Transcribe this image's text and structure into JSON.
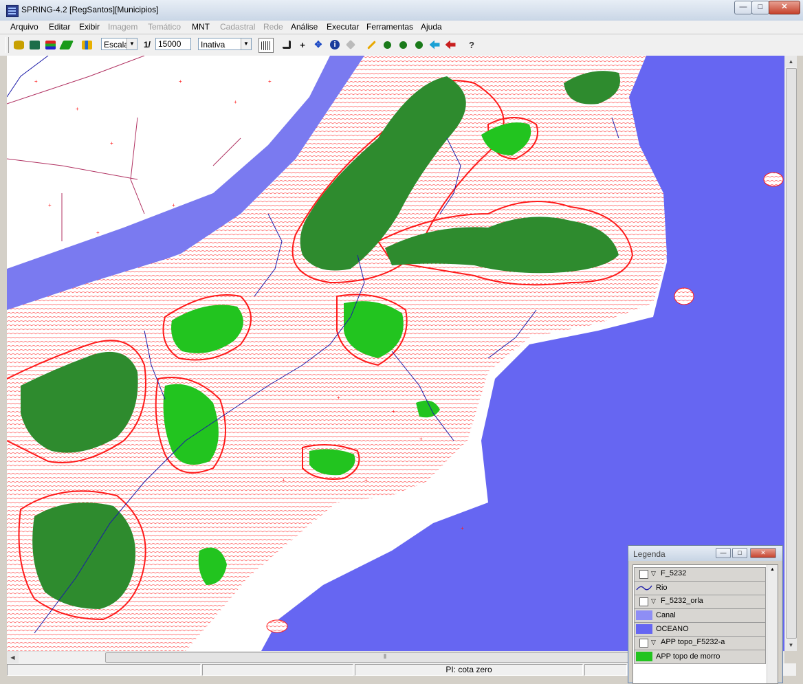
{
  "window": {
    "title": "SPRING-4.2 [RegSantos][Municipios]",
    "controls": {
      "minimize": "—",
      "maximize": "□",
      "close": "✕"
    }
  },
  "menu": [
    {
      "label": "Arquivo",
      "enabled": true
    },
    {
      "label": "Editar",
      "enabled": true
    },
    {
      "label": "Exibir",
      "enabled": true
    },
    {
      "label": "Imagem",
      "enabled": false
    },
    {
      "label": "Temático",
      "enabled": false
    },
    {
      "label": "MNT",
      "enabled": true
    },
    {
      "label": "Cadastral",
      "enabled": false
    },
    {
      "label": "Rede",
      "enabled": false
    },
    {
      "label": "Análise",
      "enabled": true
    },
    {
      "label": "Executar",
      "enabled": true
    },
    {
      "label": "Ferramentas",
      "enabled": true
    },
    {
      "label": "Ajuda",
      "enabled": true
    }
  ],
  "toolbar": {
    "scale_mode": "Escala",
    "scale_prefix": "1/",
    "scale_value": "15000",
    "cursor_mode": "Inativa",
    "icons": [
      "database-icon",
      "model-icon",
      "layers-icon",
      "draw-icon",
      "chart-icon",
      "grid-icon",
      "arrow-icon",
      "plus-icon",
      "pan-icon",
      "info-icon",
      "tag-icon",
      "pencil-icon",
      "zoom-in-icon",
      "zoom-out-icon",
      "zoom-area-icon",
      "previous-icon",
      "undo-icon",
      "help-icon"
    ],
    "glyphs": {
      "plus": "+",
      "pan": "✥",
      "info": "i",
      "help": "?"
    }
  },
  "map": {
    "colors": {
      "land": "#ffffff",
      "ocean": "#6666f2",
      "canal": "#7a7af0",
      "contour": "#ff1a1a",
      "contour_light": "#ff6a6a",
      "app_topo": "#2e8b2e",
      "app_topo_bright": "#22c41f",
      "river": "#1a1aa8",
      "boundary": "#b03060"
    },
    "elements": [
      "ocean",
      "canal",
      "hill-topo-area",
      "contour-lines",
      "rivers",
      "municipal-boundaries",
      "sample-points"
    ]
  },
  "legend": {
    "title": "Legenda",
    "controls": {
      "minimize": "—",
      "maximize": "□",
      "close": "✕"
    },
    "groups": [
      {
        "name": "F_5232",
        "entries": [
          {
            "label": "Rio",
            "swatch": "line",
            "color": "#1a1aa8"
          }
        ]
      },
      {
        "name": "F_5232_orla",
        "entries": [
          {
            "label": "Canal",
            "swatch": "fill",
            "color": "#8e8ef5"
          },
          {
            "label": "OCEANO",
            "swatch": "fill",
            "color": "#6666f2"
          }
        ]
      },
      {
        "name": "APP topo_F5232-a",
        "entries": [
          {
            "label": "APP topo de morro",
            "swatch": "fill",
            "color": "#22c41f"
          }
        ]
      }
    ]
  },
  "status": {
    "panes": [
      "",
      "",
      "PI: cota zero",
      ""
    ]
  },
  "scrollbars": {
    "arrows": {
      "up": "▲",
      "down": "▼",
      "left": "◀",
      "right": "▶"
    },
    "grip": "⦀"
  }
}
